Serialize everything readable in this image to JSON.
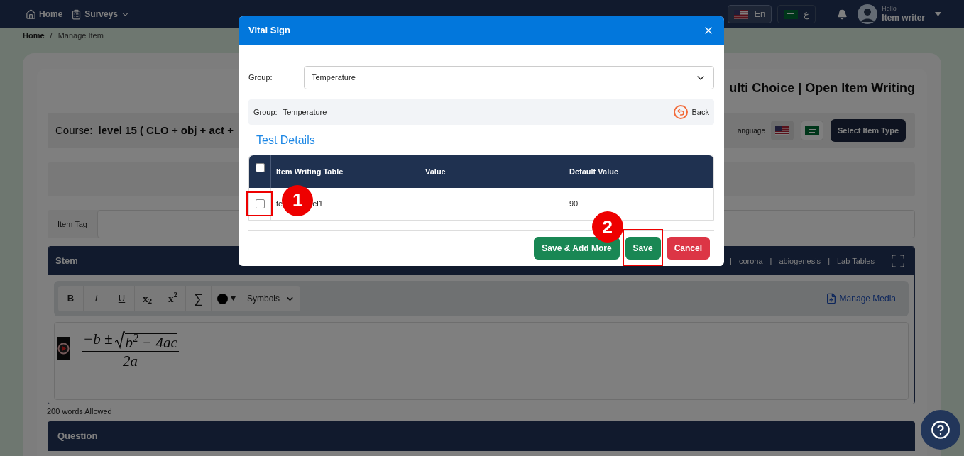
{
  "navbar": {
    "items": [
      {
        "kind": "home",
        "label": "Home"
      },
      {
        "kind": "surveys",
        "label": "Surveys"
      }
    ],
    "languages": [
      {
        "label": "En",
        "kind": "us",
        "selected": true
      },
      {
        "label": "ع",
        "kind": "sa",
        "selected": false
      }
    ],
    "greeting": "Hello",
    "user": "Item writer"
  },
  "breadcrumb": [
    "Home",
    "/",
    "Manage Item"
  ],
  "page": {
    "title": "ulti Choice | Open Item Writing",
    "course_label": "Course:",
    "course_value": "level 15 ( CLO + obj + act + ",
    "language_label": "anguage",
    "language_flags": [
      {
        "kind": "us",
        "selected": true
      },
      {
        "kind": "sa",
        "selected": false
      }
    ],
    "select_type_button": "Select Item Type",
    "item_tag_label": "Item Tag",
    "stem": {
      "title": "Stem",
      "links": [
        {
          "kind": "separator",
          "text": "|"
        },
        {
          "kind": "link",
          "text": "corona"
        },
        {
          "kind": "separator",
          "text": "|"
        },
        {
          "kind": "link",
          "text": "abiogenesis"
        },
        {
          "kind": "separator",
          "text": "|"
        },
        {
          "kind": "link",
          "text": "Lab Tables"
        }
      ],
      "toolbar": [
        {
          "kind": "bold",
          "text": "B"
        },
        {
          "kind": "italic",
          "text": "I"
        },
        {
          "kind": "underline",
          "text": "U"
        },
        {
          "kind": "script",
          "text": "x$_{2}$"
        },
        {
          "kind": "script",
          "text": "x$^{2}$"
        },
        {
          "kind": "plain",
          "text": "∑"
        },
        {
          "kind": "color"
        },
        {
          "kind": "select",
          "text": "Symbols"
        }
      ],
      "manage_media": "Manage Media",
      "formula": {
        "lead": "−b ±",
        "radicand": "b$^{2}$ − 4ac",
        "denominator": "2a"
      }
    },
    "word_limit": "200 words Allowed",
    "question_title": "Question"
  },
  "modal": {
    "title": "Vital Sign",
    "group_label": "Group:",
    "group_value": "Temperature",
    "info_label": "Group:",
    "info_value": "Temperature",
    "back": "Back",
    "section_title": "Test Details",
    "table": {
      "columns": [
        "Item Writing Table",
        "Value",
        "Default Value"
      ],
      "header_checked": false,
      "rows": [
        {
          "checked": false,
          "highlighted": true,
          "cells": [
            {
              "parts": [
                "te",
                "el1"
              ],
              "annotation": "1"
            },
            {},
            {
              "parts": [
                "90"
              ]
            }
          ]
        }
      ]
    },
    "buttons": [
      {
        "kind": "save_more",
        "label": "Save & Add More"
      },
      {
        "kind": "save",
        "label": "Save",
        "highlighted": true,
        "annotation": "2"
      },
      {
        "kind": "cancel",
        "label": "Cancel"
      }
    ]
  }
}
